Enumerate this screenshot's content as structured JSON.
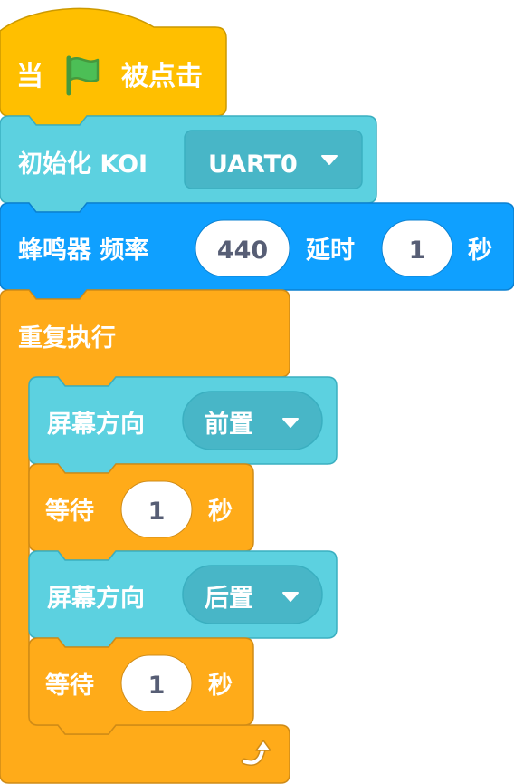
{
  "colors": {
    "events": "#FFBF00",
    "events_stroke": "#CC9900",
    "extension": "#5CD1E0",
    "extension_stroke": "#3AAFC0",
    "extension_dark": "#48B6C7",
    "sound": "#0FA0FF",
    "sound_stroke": "#0B80D0",
    "control": "#FFAB19",
    "control_stroke": "#CF8B17",
    "flag": "#4CBF56",
    "flag_stroke": "#45993D",
    "text_light": "#FFFFFF",
    "text_dark": "#575E75"
  },
  "hat_block": {
    "prefix": "当",
    "icon": "green-flag-icon",
    "suffix": "被点击"
  },
  "init_block": {
    "label": "初始化 KOI",
    "dropdown_value": "UART0"
  },
  "buzzer_block": {
    "label_freq": "蜂鸣器 频率",
    "freq_value": "440",
    "label_delay": "延时",
    "delay_value": "1",
    "label_unit": "秒"
  },
  "forever_block": {
    "label": "重复执行",
    "loop_icon": "loop-arrow-icon"
  },
  "inner_blocks": [
    {
      "type": "screen",
      "label": "屏幕方向",
      "dropdown_value": "前置"
    },
    {
      "type": "wait",
      "label": "等待",
      "value": "1",
      "unit": "秒"
    },
    {
      "type": "screen",
      "label": "屏幕方向",
      "dropdown_value": "后置"
    },
    {
      "type": "wait",
      "label": "等待",
      "value": "1",
      "unit": "秒"
    }
  ]
}
